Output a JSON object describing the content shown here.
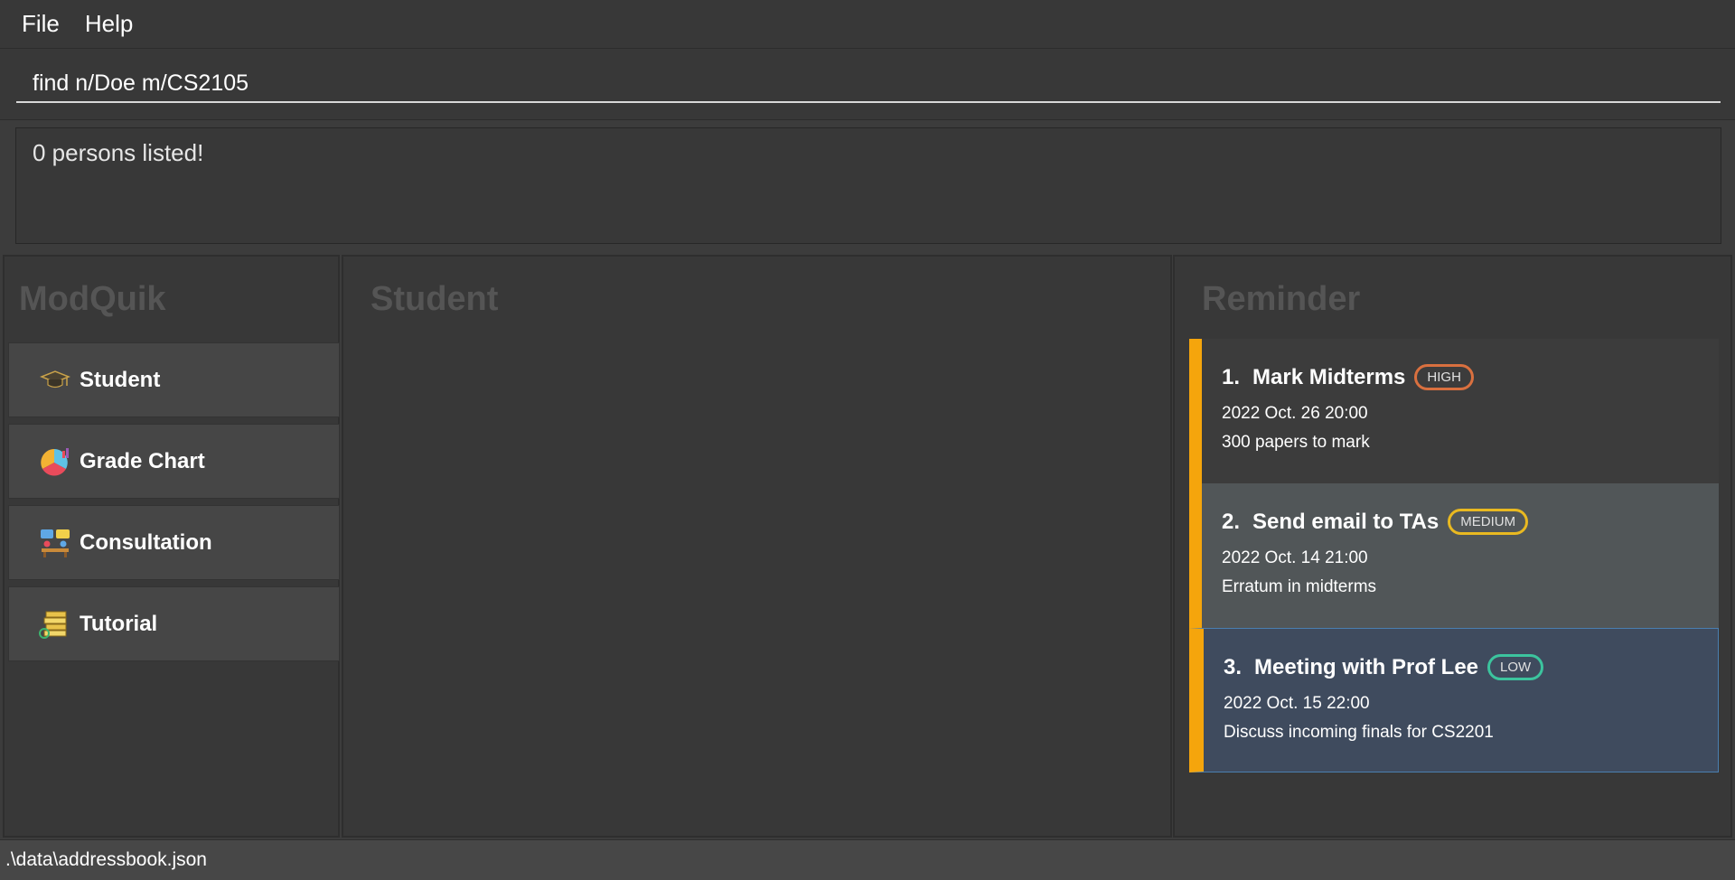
{
  "menu": {
    "items": [
      "File",
      "Help"
    ]
  },
  "command": {
    "value": "find n/Doe m/CS2105"
  },
  "result": {
    "message": "0 persons listed!"
  },
  "sidebar": {
    "title": "ModQuik",
    "items": [
      {
        "label": "Student",
        "icon": "graduation-cap-icon"
      },
      {
        "label": "Grade Chart",
        "icon": "pie-chart-icon"
      },
      {
        "label": "Consultation",
        "icon": "meeting-icon"
      },
      {
        "label": "Tutorial",
        "icon": "books-icon"
      }
    ]
  },
  "main": {
    "title": "Student"
  },
  "reminders": {
    "title": "Reminder",
    "items": [
      {
        "index": "1.",
        "title": "Mark Midterms",
        "priority": "HIGH",
        "date": "2022 Oct. 26 20:00",
        "description": "300 papers to mark"
      },
      {
        "index": "2.",
        "title": "Send email to TAs",
        "priority": "MEDIUM",
        "date": "2022 Oct. 14 21:00",
        "description": "Erratum in midterms"
      },
      {
        "index": "3.",
        "title": "Meeting with Prof Lee",
        "priority": "LOW",
        "date": "2022 Oct. 15 22:00",
        "description": "Discuss incoming finals for CS2201"
      }
    ]
  },
  "status": {
    "file_path": ".\\data\\addressbook.json"
  },
  "colors": {
    "accent": "#f5a50c",
    "high": "#d9703f",
    "medium": "#e9b921",
    "low": "#3cc49e"
  }
}
